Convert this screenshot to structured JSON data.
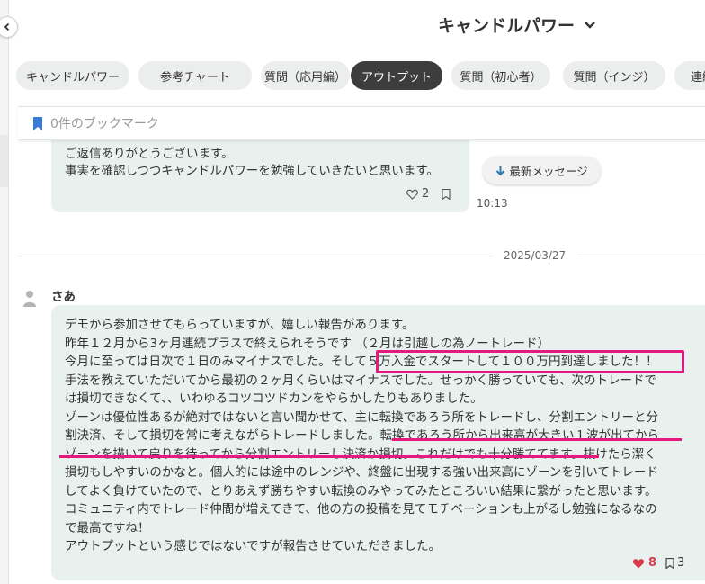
{
  "header": {
    "title": "キャンドルパワー"
  },
  "tabs": [
    {
      "label": "キャンドルパワー"
    },
    {
      "label": "参考チャート"
    },
    {
      "label": "質問（応用編）"
    },
    {
      "label": "アウトプット",
      "active": true
    },
    {
      "label": "質問（初心者）"
    },
    {
      "label": "質問（インジ）"
    },
    {
      "label": "連続"
    }
  ],
  "bookmark_bar": {
    "label": "0件のブックマーク"
  },
  "message1": {
    "lines": [
      "ご返信ありがとうございます。",
      "事実を確認しつつキャンドルパワーを勉強していきたいと思います。"
    ],
    "likes": "2",
    "time": "10:13"
  },
  "latest_button": {
    "label": "最新メッセージ"
  },
  "date_separator": "2025/03/27",
  "message2": {
    "author": "さあ",
    "lines": [
      "デモから参加させてもらっていますが、嬉しい報告があります。",
      "昨年１２月から3ヶ月連続プラスで終えられそうです （２月は引越しの為ノートレード）",
      "今月に至っては日次で１日のみマイナスでした。そして５万入金でスタートして１００万円到達しました！！",
      "手法を教えていただいてから最初の２ヶ月くらいはマイナスでした。せっかく勝っていても、次のトレードで",
      "は損切できなくて、、いわゆるコツコツドカンをやらかしたりもありました。",
      "ゾーンは優位性あるが絶対ではないと言い聞かせて、主に転換であろう所をトレードし、分割エントリーと分",
      "割決済、そして損切を常に考えながらトレードしました。転換であろう所から出来高が大きい１波が出てから",
      "ゾーンを描いて戻りを待ってから分割エントリーし決済か損切。これだけでも十分勝ててます。抜けたら潔く",
      "損切もしやすいのかなと。個人的には途中のレンジや、終盤に出現する強い出来高にゾーンを引いてトレード",
      "してよく負けていたので、とりあえず勝ちやすい転換のみやってみたところいい結果に繋がったと思います。",
      "コミュニティ内でトレード仲間が増えてきて、他の方の投稿を見てモチベーションも上がるし勉強になるなの",
      "で最高ですね！",
      "アウトプットという感じではないですが報告させていただきました。"
    ],
    "likes": "8",
    "bookmarks": "3"
  },
  "colors": {
    "accent_highlight": "#e5197e",
    "bubble_bg": "#e9f1ef",
    "active_tab_bg": "#3d3d3d",
    "bookmark_icon": "#3a7bd5",
    "like_red": "#d93a4a"
  },
  "icons": [
    "chevron-left-icon",
    "chevron-down-icon",
    "bookmark-icon",
    "heart-outline-icon",
    "arrow-down-icon",
    "avatar-icon",
    "heart-filled-icon"
  ]
}
